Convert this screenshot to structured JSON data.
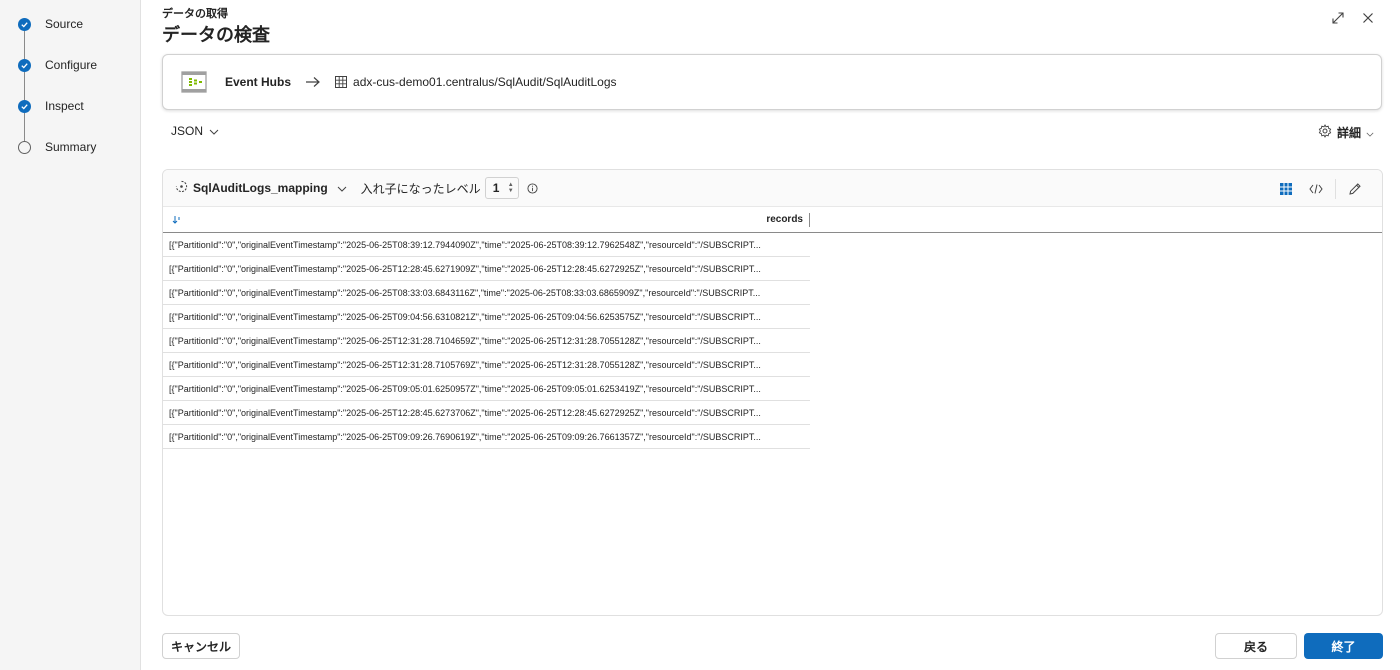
{
  "steps": [
    {
      "label": "Source",
      "status": "done"
    },
    {
      "label": "Configure",
      "status": "done"
    },
    {
      "label": "Inspect",
      "status": "done"
    },
    {
      "label": "Summary",
      "status": "todo"
    }
  ],
  "header": {
    "breadcrumb": "データの取得",
    "title": "データの検査"
  },
  "source": {
    "name": "Event Hubs",
    "destination": "adx-cus-demo01.centralus/SqlAudit/SqlAuditLogs"
  },
  "format": "JSON",
  "details_label": "詳細",
  "grid": {
    "mapping_name": "SqlAuditLogs_mapping",
    "nested_level_label": "入れ子になったレベル",
    "nested_level_value": "1",
    "column_header": "records",
    "rows": [
      "[{\"PartitionId\":\"0\",\"originalEventTimestamp\":\"2025-06-25T08:39:12.7944090Z\",\"time\":\"2025-06-25T08:39:12.7962548Z\",\"resourceId\":\"/SUBSCRIPT...",
      "[{\"PartitionId\":\"0\",\"originalEventTimestamp\":\"2025-06-25T12:28:45.6271909Z\",\"time\":\"2025-06-25T12:28:45.6272925Z\",\"resourceId\":\"/SUBSCRIPT...",
      "[{\"PartitionId\":\"0\",\"originalEventTimestamp\":\"2025-06-25T08:33:03.6843116Z\",\"time\":\"2025-06-25T08:33:03.6865909Z\",\"resourceId\":\"/SUBSCRIPT...",
      "[{\"PartitionId\":\"0\",\"originalEventTimestamp\":\"2025-06-25T09:04:56.6310821Z\",\"time\":\"2025-06-25T09:04:56.6253575Z\",\"resourceId\":\"/SUBSCRIPT...",
      "[{\"PartitionId\":\"0\",\"originalEventTimestamp\":\"2025-06-25T12:31:28.7104659Z\",\"time\":\"2025-06-25T12:31:28.7055128Z\",\"resourceId\":\"/SUBSCRIPT...",
      "[{\"PartitionId\":\"0\",\"originalEventTimestamp\":\"2025-06-25T12:31:28.7105769Z\",\"time\":\"2025-06-25T12:31:28.7055128Z\",\"resourceId\":\"/SUBSCRIPT...",
      "[{\"PartitionId\":\"0\",\"originalEventTimestamp\":\"2025-06-25T09:05:01.6250957Z\",\"time\":\"2025-06-25T09:05:01.6253419Z\",\"resourceId\":\"/SUBSCRIPT...",
      "[{\"PartitionId\":\"0\",\"originalEventTimestamp\":\"2025-06-25T12:28:45.6273706Z\",\"time\":\"2025-06-25T12:28:45.6272925Z\",\"resourceId\":\"/SUBSCRIPT...",
      "[{\"PartitionId\":\"0\",\"originalEventTimestamp\":\"2025-06-25T09:09:26.7690619Z\",\"time\":\"2025-06-25T09:09:26.7661357Z\",\"resourceId\":\"/SUBSCRIPT..."
    ]
  },
  "footer": {
    "cancel_label": "キャンセル",
    "back_label": "戻る",
    "finish_label": "終了"
  },
  "colors": {
    "accent": "#0f6cbd",
    "sidebar_bg": "#f5f5f5",
    "event_hubs_green": "#7fba00"
  },
  "icons": {
    "top_right": [
      "expand-icon",
      "close-icon"
    ],
    "toolbar": [
      "grid-view-icon",
      "code-view-icon",
      "edit-icon"
    ]
  }
}
